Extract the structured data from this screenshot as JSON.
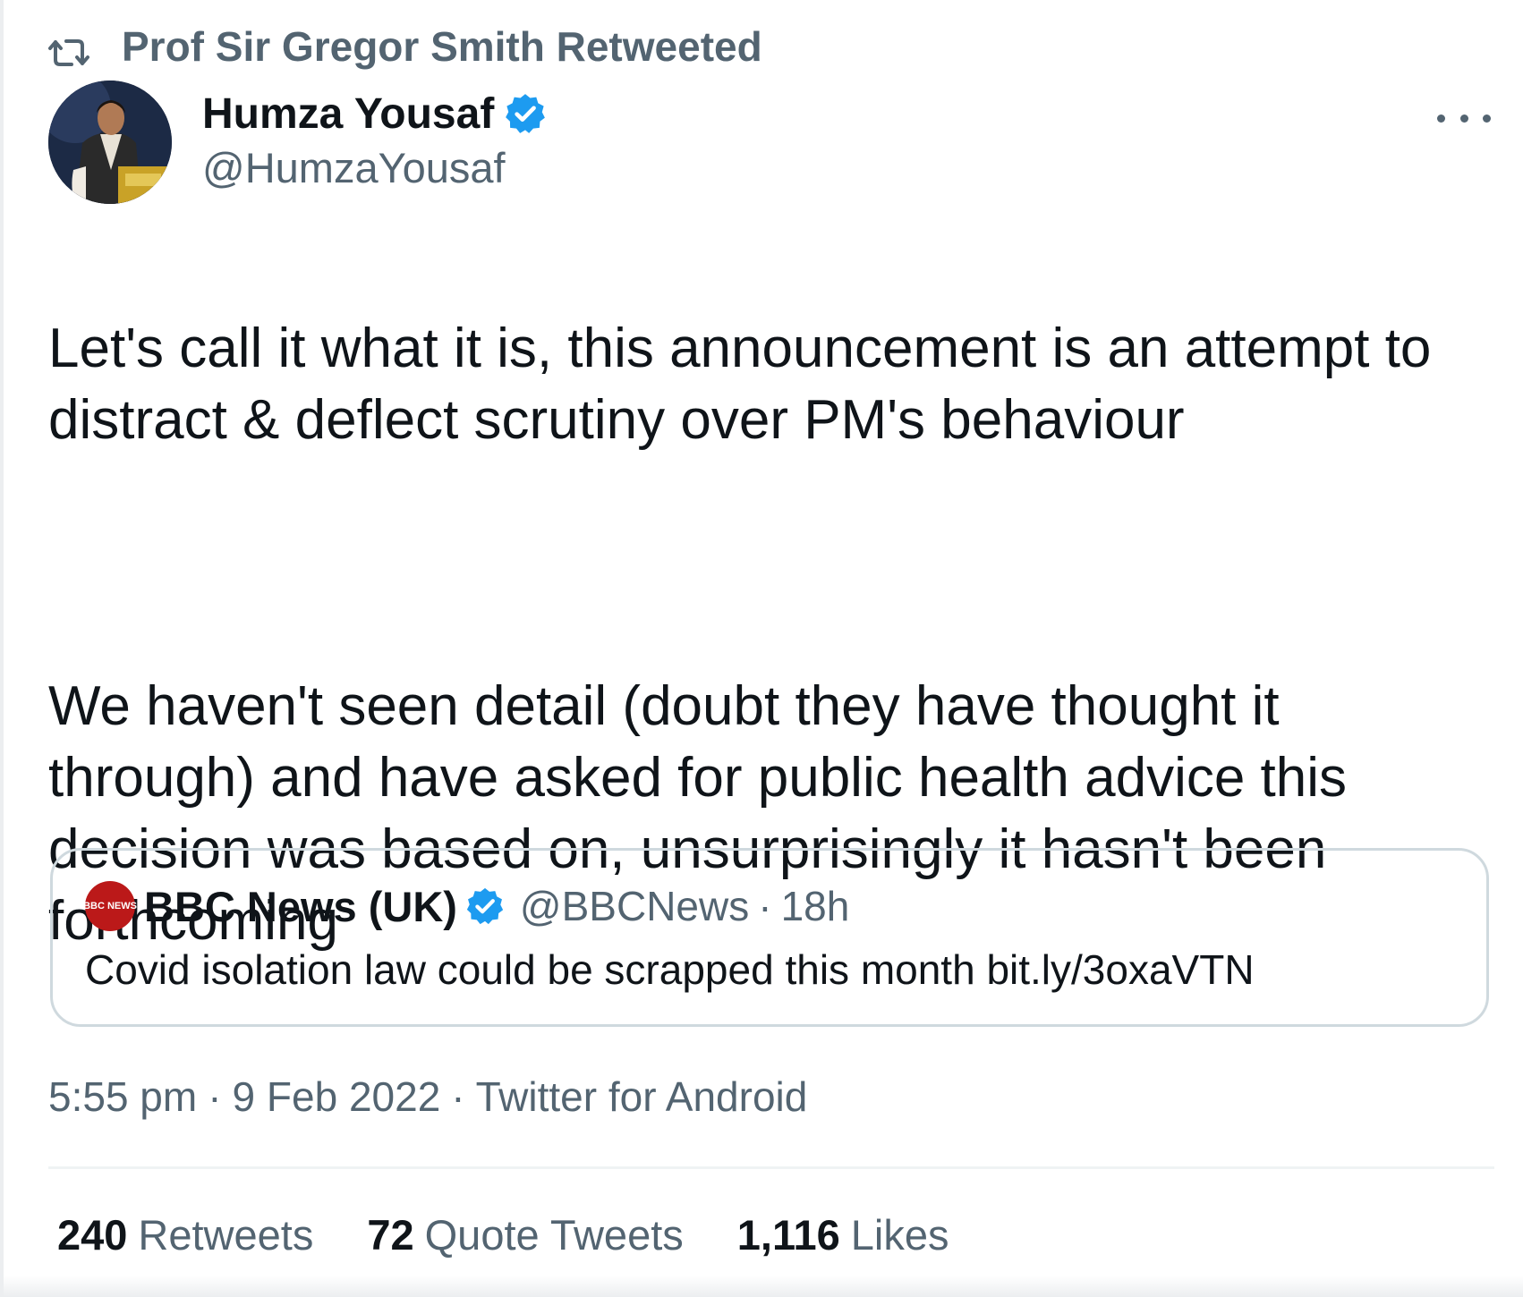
{
  "retweet_context": {
    "icon": "retweet-icon",
    "text": "Prof Sir Gregor Smith Retweeted"
  },
  "author": {
    "name": "Humza Yousaf",
    "handle": "@HumzaYousaf",
    "verified_icon": "verified-badge-icon",
    "avatar": "profile-photo"
  },
  "more_icon": "more-options-icon",
  "tweet": {
    "paragraph_1": "Let's call it what it is, this announcement is an attempt to distract & deflect scrutiny over PM's behaviour",
    "paragraph_2": "We haven't seen detail (doubt they have thought it through) and have asked for public health advice this decision was based on, unsurprisingly it hasn't been forthcoming"
  },
  "quote_tweet": {
    "avatar_label": "BBC NEWS",
    "name": "BBC News (UK)",
    "handle": "@BBCNews",
    "separator": "·",
    "time": "18h",
    "text": "Covid isolation law could be scrapped this month bit.ly/3oxaVTN"
  },
  "meta": {
    "time": "5:55 pm",
    "separator": "·",
    "date": "9 Feb 2022",
    "source": "Twitter for Android"
  },
  "stats": {
    "retweets_count": "240",
    "retweets_label": "Retweets",
    "quotes_count": "72",
    "quotes_label": "Quote Tweets",
    "likes_count": "1,116",
    "likes_label": "Likes"
  },
  "colors": {
    "text_primary": "#0f1419",
    "text_secondary": "#536471",
    "verified_blue": "#1d9bf0",
    "bbc_red": "#bb1919",
    "border": "#cfd9de"
  }
}
